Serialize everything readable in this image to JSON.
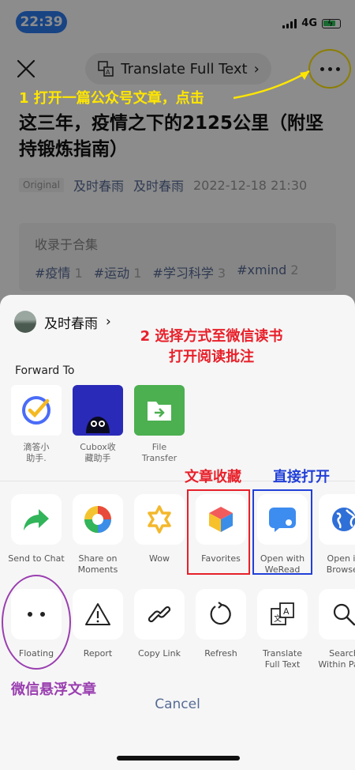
{
  "status": {
    "time": "22:39",
    "network": "4G"
  },
  "nav": {
    "pill_label": "Translate Full Text"
  },
  "annotations": {
    "step1": "1 打开一篇公众号文章，点击",
    "step2": "2 选择方式至微信读书\n打开阅读批注",
    "favorites_note": "文章收藏",
    "open_note": "直接打开",
    "floating_note": "微信悬浮文章"
  },
  "article": {
    "title": "这三年，疫情之下的2125公里（附坚持锻炼指南）",
    "badge": "Original",
    "author": "及时春雨",
    "account": "及时春雨",
    "date": "2022-12-18 21:30",
    "collection_head": "收录于合集",
    "tags": [
      {
        "name": "#疫情",
        "count": "1"
      },
      {
        "name": "#运动",
        "count": "1"
      },
      {
        "name": "#学习科学",
        "count": "3"
      },
      {
        "name": "#xmind",
        "count": "2"
      }
    ]
  },
  "sheet": {
    "account_name": "及时春雨",
    "forward_label": "Forward To",
    "forward": [
      {
        "label": "滴答小\n助手."
      },
      {
        "label": "Cubox收\n藏助手"
      },
      {
        "label": "File\nTransfer"
      }
    ],
    "row1": [
      {
        "label": "Send to Chat"
      },
      {
        "label": "Share on\nMoments"
      },
      {
        "label": "Wow"
      },
      {
        "label": "Favorites"
      },
      {
        "label": "Open with\nWeRead"
      },
      {
        "label": "Open in\nBrowser"
      }
    ],
    "row2": [
      {
        "label": "Floating"
      },
      {
        "label": "Report"
      },
      {
        "label": "Copy Link"
      },
      {
        "label": "Refresh"
      },
      {
        "label": "Translate\nFull Text"
      },
      {
        "label": "Search\nWithin Page"
      }
    ],
    "cancel": "Cancel"
  },
  "colors": {
    "annotation_yellow": "#ffe600",
    "annotation_red": "#e8202a",
    "annotation_blue": "#2240d8",
    "annotation_purple": "#9a3fb0",
    "link_blue": "#576b95"
  }
}
